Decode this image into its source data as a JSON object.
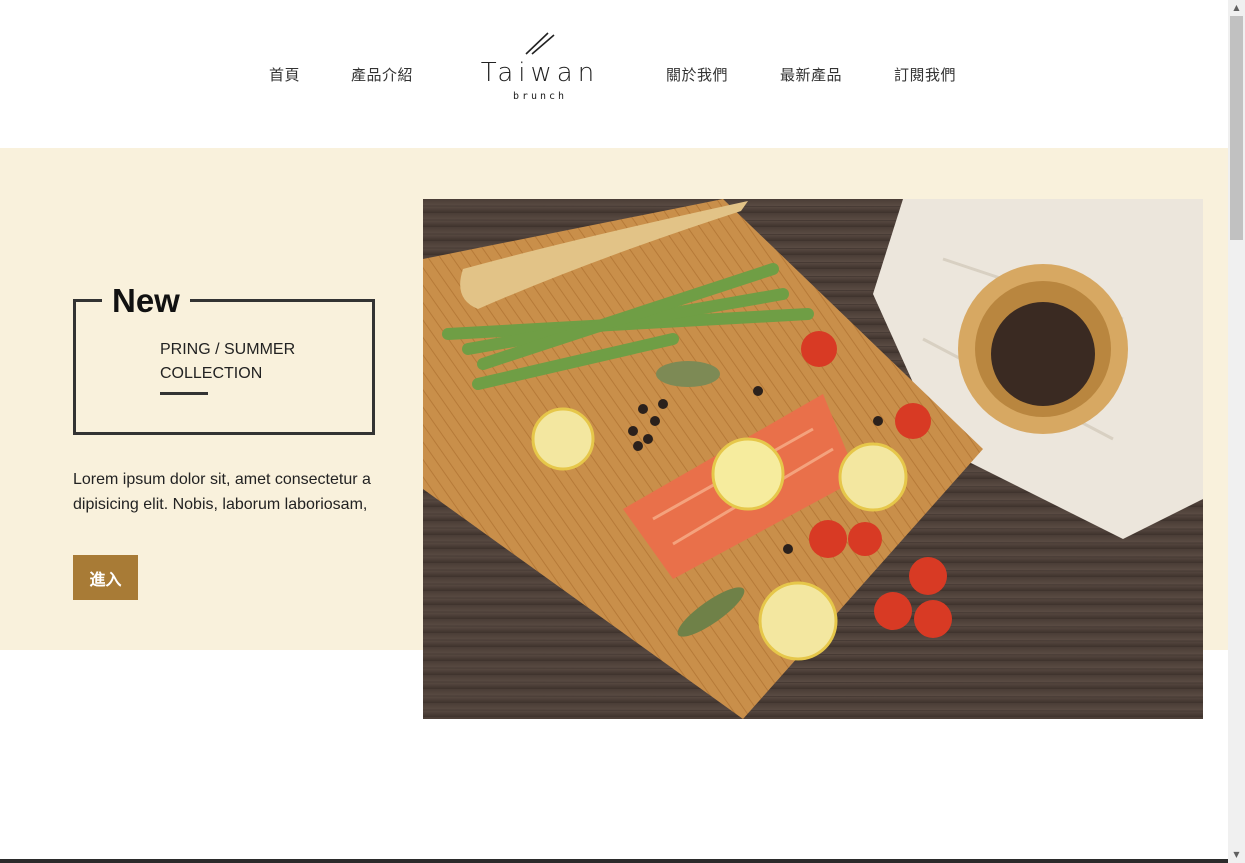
{
  "nav": {
    "home": "首頁",
    "products": "產品介紹",
    "about": "關於我們",
    "latest": "最新產品",
    "subscribe": "訂閱我們"
  },
  "logo": {
    "name": "Taiwan",
    "sub": "brunch",
    "icon": "chopsticks-icon"
  },
  "hero": {
    "badge": "New",
    "collection": "PRING / SUMMER COLLECTION",
    "description": "Lorem ipsum dolor sit, amet consectetur adipisicing elit. Nobis, laborum laboriosam,",
    "button_label": "進入",
    "image": "food-photo-salmon-cutting-board"
  },
  "colors": {
    "hero_background": "#f9f1dc",
    "button_background": "#a87b36",
    "border": "#333333"
  }
}
